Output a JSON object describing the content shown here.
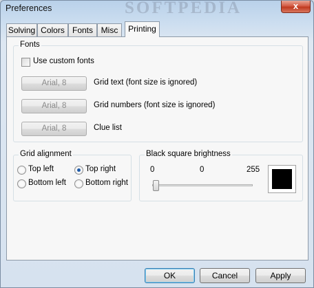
{
  "window": {
    "title": "Preferences",
    "watermark": "SOFTPEDIA",
    "close_glyph": "x"
  },
  "tabs": [
    {
      "label": "Solving",
      "active": false
    },
    {
      "label": "Colors",
      "active": false
    },
    {
      "label": "Fonts",
      "active": false
    },
    {
      "label": "Misc",
      "active": false
    },
    {
      "label": "Printing",
      "active": true
    }
  ],
  "fonts": {
    "group_label": "Fonts",
    "use_custom_label": "Use custom fonts",
    "use_custom_checked": false,
    "rows": [
      {
        "button": "Arial, 8",
        "label": "Grid text (font size is ignored)"
      },
      {
        "button": "Arial, 8",
        "label": "Grid numbers (font size is ignored)"
      },
      {
        "button": "Arial, 8",
        "label": "Clue list"
      }
    ]
  },
  "grid_alignment": {
    "group_label": "Grid alignment",
    "options": [
      {
        "label": "Top left",
        "checked": false
      },
      {
        "label": "Top right",
        "checked": true
      },
      {
        "label": "Bottom left",
        "checked": false
      },
      {
        "label": "Bottom right",
        "checked": false
      }
    ]
  },
  "brightness": {
    "group_label": "Black square brightness",
    "min_label": "0",
    "value_label": "0",
    "max_label": "255",
    "value": 0,
    "swatch_color": "#000000"
  },
  "buttons": {
    "ok": "OK",
    "cancel": "Cancel",
    "apply": "Apply"
  }
}
